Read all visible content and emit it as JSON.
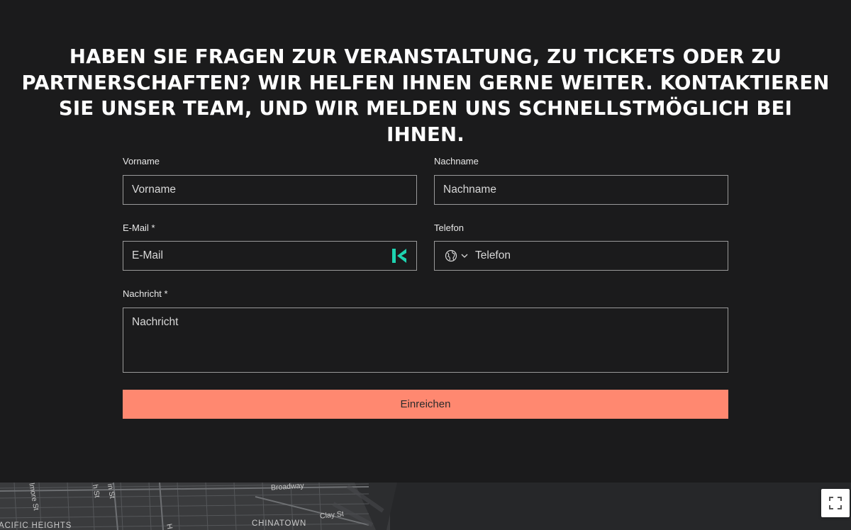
{
  "headline": "HABEN SIE FRAGEN ZUR VERANSTALTUNG, ZU TICKETS ODER ZU PARTNERSCHAFTEN? WIR HELFEN IHNEN GERNE WEITER. KONTAKTIEREN SIE UNSER TEAM, UND WIR MELDEN UNS SCHNELLSTMÖGLICH BEI IHNEN.",
  "form": {
    "first_name": {
      "label": "Vorname",
      "placeholder": "Vorname"
    },
    "last_name": {
      "label": "Nachname",
      "placeholder": "Nachname"
    },
    "email": {
      "label": "E-Mail *",
      "placeholder": "E-Mail",
      "autofill_icon": "k-autofill-icon"
    },
    "phone": {
      "label": "Telefon",
      "placeholder": "Telefon",
      "country_icon": "globe-icon"
    },
    "message": {
      "label": "Nachricht *",
      "placeholder": "Nachricht"
    },
    "submit_label": "Einreichen"
  },
  "map": {
    "labels": [
      "Broadway",
      "Clay St",
      "CHINATOWN",
      "ACIFIC HEIGHTS",
      "lmore St",
      "h St",
      "in St",
      "H"
    ],
    "fullscreen_icon": "fullscreen-icon"
  },
  "colors": {
    "background": "#1b1b1c",
    "accent": "#ff8870",
    "autofill_icon": "#1ed3b0"
  }
}
